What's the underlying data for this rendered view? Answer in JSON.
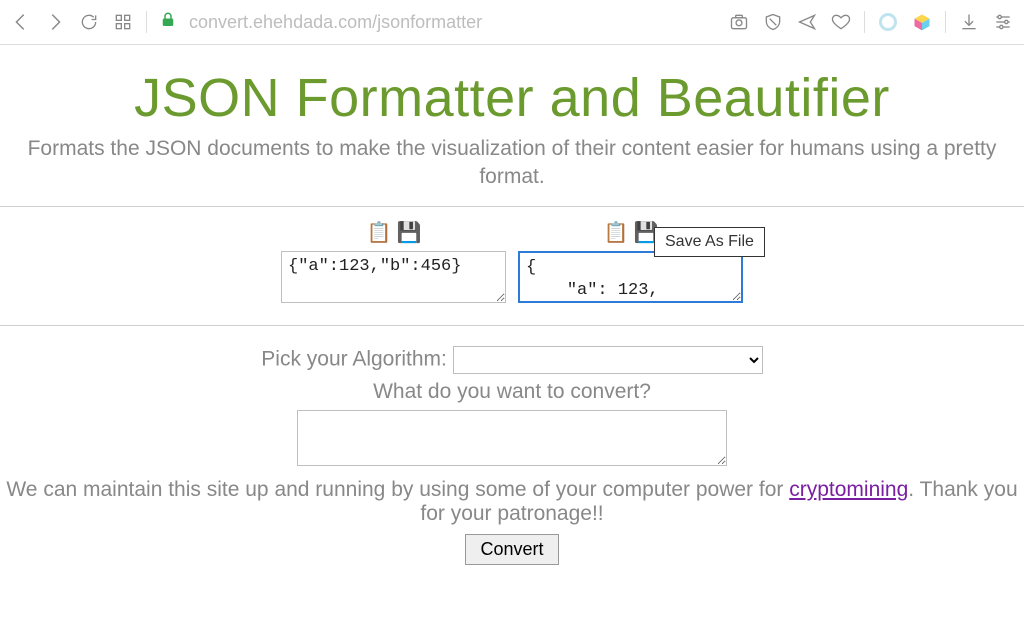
{
  "browser": {
    "url_host": "convert.ehehdada.com",
    "url_path": "/jsonformatter"
  },
  "page": {
    "title": "JSON Formatter and Beautifier",
    "subtitle": "Formats the JSON documents to make the visualization of their content easier for humans using a pretty format."
  },
  "io": {
    "input_value": "{\"a\":123,\"b\":456}",
    "output_value": "{\n    \"a\": 123,",
    "save_tooltip": "Save As File"
  },
  "form": {
    "algo_label": "Pick your Algorithm:",
    "wish_label": "What do you want to convert?",
    "footer_before": "We can maintain this site up and running by using some of your computer power for ",
    "footer_link": "cryptomining",
    "footer_after": ". Thank you for your patronage!!",
    "convert_label": "Convert"
  }
}
